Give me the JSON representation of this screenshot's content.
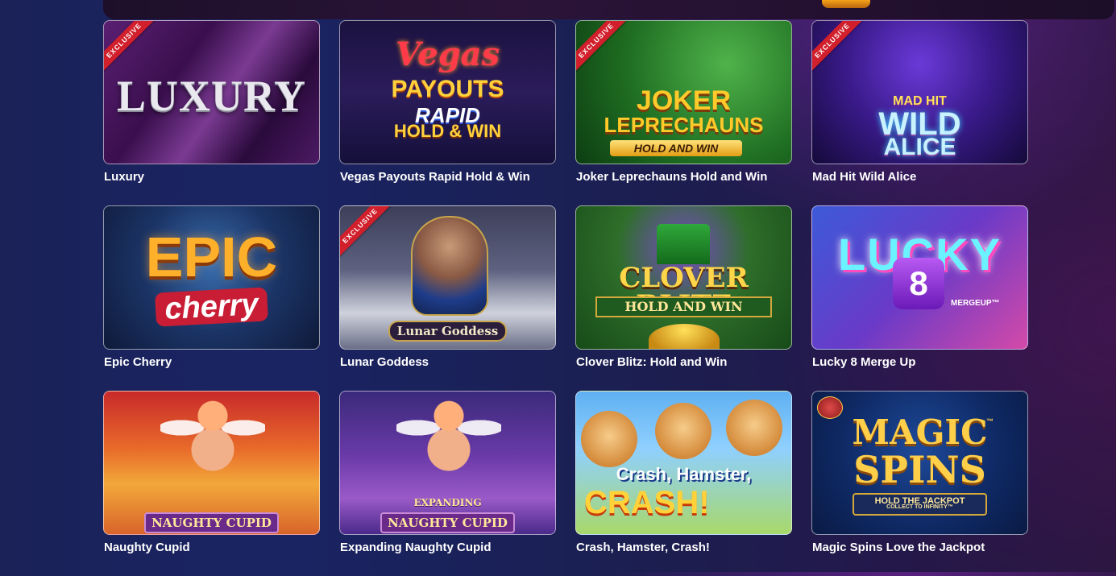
{
  "ribbon_label": "EXCLUSIVE",
  "games": [
    {
      "title": "Luxury",
      "exclusive": true,
      "art": {
        "l1": "LUXURY"
      }
    },
    {
      "title": "Vegas Payouts Rapid Hold & Win",
      "exclusive": false,
      "art": {
        "l1": "Vegas",
        "l2": "PAYOUTS",
        "l3": "RAPID",
        "l4": "HOLD & WIN"
      }
    },
    {
      "title": "Joker Leprechauns Hold and Win",
      "exclusive": true,
      "art": {
        "l1": "JOKER",
        "l2": "LEPRECHAUNS",
        "l3": "HOLD AND WIN"
      }
    },
    {
      "title": "Mad Hit Wild Alice",
      "exclusive": true,
      "art": {
        "l1": "MAD HIT",
        "l2": "WILD",
        "l3": "ALICE"
      }
    },
    {
      "title": "Epic Cherry",
      "exclusive": false,
      "art": {
        "l1": "EPIC",
        "l2": "cherry"
      }
    },
    {
      "title": "Lunar Goddess",
      "exclusive": true,
      "art": {
        "l1": "Lunar Goddess"
      }
    },
    {
      "title": "Clover Blitz: Hold and Win",
      "exclusive": false,
      "art": {
        "l1": "CLOVER BLITZ",
        "l2": "HOLD AND WIN"
      }
    },
    {
      "title": "Lucky 8 Merge Up",
      "exclusive": false,
      "art": {
        "l1": "LUCKY",
        "l2": "8",
        "l3": "MERGEUP™"
      }
    },
    {
      "title": "Naughty Cupid",
      "exclusive": false,
      "art": {
        "l1": "NAUGHTY CUPID"
      }
    },
    {
      "title": "Expanding Naughty Cupid",
      "exclusive": false,
      "art": {
        "l1": "EXPANDING",
        "l2": "NAUGHTY CUPID"
      }
    },
    {
      "title": "Crash, Hamster, Crash!",
      "exclusive": false,
      "art": {
        "l1": "Crash, Hamster,",
        "l2": "CRASH!"
      }
    },
    {
      "title": "Magic Spins Love the Jackpot",
      "exclusive": false,
      "art": {
        "l1": "MAGIC",
        "l2": "SPINS",
        "l3": "HOLD THE JACKPOT",
        "l4": "COLLECT TO INFINITY™",
        "tm": "™"
      }
    }
  ]
}
